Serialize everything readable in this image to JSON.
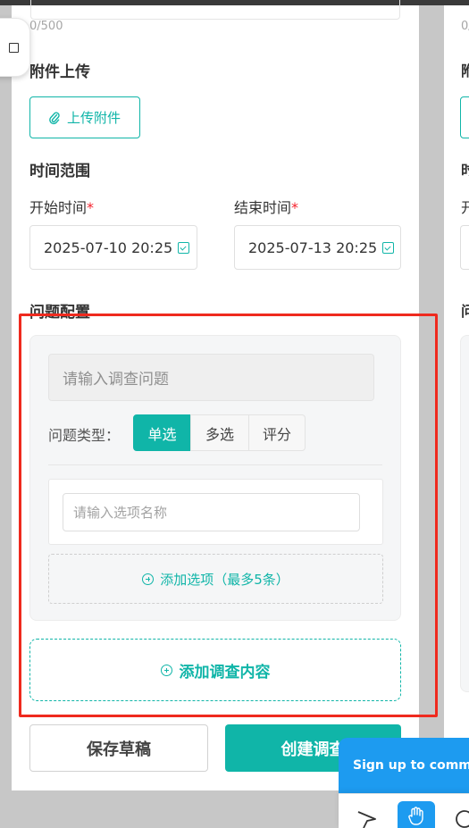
{
  "form": {
    "char_counter": "0/500",
    "attachment": {
      "heading": "附件上传",
      "upload_label": "上传附件"
    },
    "time_range": {
      "heading": "时间范围",
      "start_label": "开始时间",
      "end_label": "结束时间",
      "required_mark": "*",
      "start_value": "2025-07-10 20:25",
      "end_value": "2025-07-13 20:25"
    },
    "question_config": {
      "heading": "问题配置",
      "question_placeholder": "请输入调查问题",
      "type_label": "问题类型：",
      "types": [
        "单选",
        "多选",
        "评分"
      ],
      "selected_type": "单选",
      "option_placeholder": "请输入选项名称",
      "add_option_label": "添加选项（最多5条）",
      "add_content_label": "添加调查内容"
    },
    "actions": {
      "save_draft": "保存草稿",
      "create": "创建调查"
    }
  },
  "right_panel": {
    "counter_partial": "0/",
    "heading1_partial": "附",
    "heading2_partial": "时",
    "label_partial": "开",
    "heading3_partial": "问"
  },
  "overlay": {
    "signup_text": "Sign up to comment",
    "tools": [
      "pointer-icon",
      "hand-icon",
      "comment-icon"
    ]
  },
  "colors": {
    "accent": "#10b5a8",
    "highlight": "#ef2a1e",
    "overlay_blue": "#1d9bf0"
  }
}
